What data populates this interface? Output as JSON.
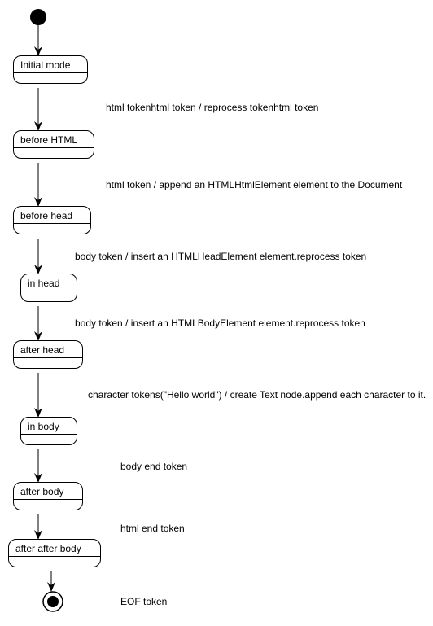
{
  "states": {
    "s0": "Initial mode",
    "s1": "before HTML",
    "s2": "before head",
    "s3": "in head",
    "s4": "after head",
    "s5": "in body",
    "s6": "after body",
    "s7": "after after body"
  },
  "edges": {
    "e0": "html tokenhtml token / reprocess tokenhtml token",
    "e1": "html token / append an HTMLHtmlElement element to the Document",
    "e2": "body token / insert an HTMLHeadElement element.reprocess token",
    "e3": "body token / insert an HTMLBodyElement element.reprocess token",
    "e4": "character tokens(\"Hello world\") / create Text node.append each character to it.",
    "e5": "body end token",
    "e6": "html end token",
    "e7": "EOF token"
  },
  "chart_data": {
    "type": "uml-state-diagram",
    "initial": "start",
    "final": "end",
    "states": [
      {
        "id": "s0",
        "label": "Initial mode"
      },
      {
        "id": "s1",
        "label": "before HTML"
      },
      {
        "id": "s2",
        "label": "before head"
      },
      {
        "id": "s3",
        "label": "in head"
      },
      {
        "id": "s4",
        "label": "after head"
      },
      {
        "id": "s5",
        "label": "in body"
      },
      {
        "id": "s6",
        "label": "after body"
      },
      {
        "id": "s7",
        "label": "after after body"
      }
    ],
    "transitions": [
      {
        "from": "start",
        "to": "s0",
        "label": ""
      },
      {
        "from": "s0",
        "to": "s1",
        "label": "html tokenhtml token / reprocess tokenhtml token"
      },
      {
        "from": "s1",
        "to": "s2",
        "label": "html token / append an HTMLHtmlElement element to the Document"
      },
      {
        "from": "s2",
        "to": "s3",
        "label": "body token / insert an HTMLHeadElement element.reprocess token"
      },
      {
        "from": "s3",
        "to": "s4",
        "label": "body token / insert an HTMLBodyElement element.reprocess token"
      },
      {
        "from": "s4",
        "to": "s5",
        "label": "character tokens(\"Hello world\") / create Text node.append each character to it."
      },
      {
        "from": "s5",
        "to": "s6",
        "label": "body end token"
      },
      {
        "from": "s6",
        "to": "s7",
        "label": "html end token"
      },
      {
        "from": "s7",
        "to": "end",
        "label": "EOF token"
      }
    ]
  }
}
